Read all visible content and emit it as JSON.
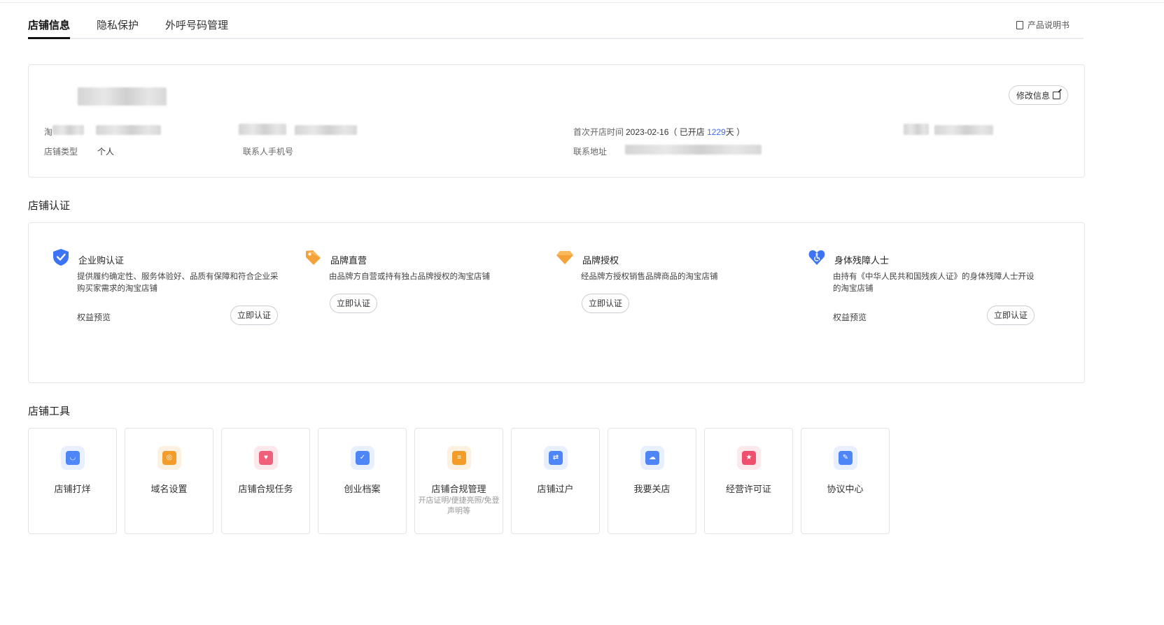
{
  "tabs": [
    {
      "label": "店铺信息"
    },
    {
      "label": "隐私保护"
    },
    {
      "label": "外呼号码管理"
    }
  ],
  "manual_label": "产品说明书",
  "info": {
    "edit_button": "修改信息",
    "shop_label_partial": "淘",
    "first_open_label": "首次开店时间",
    "first_open_date": "2023-02-16",
    "open_prefix": "（ 已开店 ",
    "open_days": "1229",
    "open_suffix": "天 ）",
    "shop_type_label": "店铺类型",
    "shop_type_value": "个人",
    "contact_phone_label": "联系人手机号",
    "address_label": "联系地址"
  },
  "cert_section_title": "店铺认证",
  "certs": [
    {
      "title": "企业购认证",
      "desc": "提供履约确定性、服务体验好、品质有保障和符合企业采购买家需求的淘宝店铺",
      "link": "权益预览",
      "button": "立即认证",
      "icon": "shield-check-icon",
      "color": "#3d73f5"
    },
    {
      "title": "品牌直营",
      "desc": "由品牌方自营或持有独占品牌授权的淘宝店铺",
      "link": "",
      "button": "立即认证",
      "icon": "tag-icon",
      "color": "#f5a23a"
    },
    {
      "title": "品牌授权",
      "desc": "经品牌方授权销售品牌商品的淘宝店铺",
      "link": "",
      "button": "立即认证",
      "icon": "diamond-icon",
      "color": "#f5a23a"
    },
    {
      "title": "身体残障人士",
      "desc": "由持有《中华人民共和国残疾人证》的身体残障人士开设的淘宝店铺",
      "link": "权益预览",
      "button": "立即认证",
      "icon": "heart-accessibility-icon",
      "color": "#3d73f5"
    }
  ],
  "tools_section_title": "店铺工具",
  "tools": [
    {
      "label": "店铺打烊",
      "sub": "",
      "icon": "shop-close-icon",
      "color": "#4f86f7",
      "bg": "#e8f0fe"
    },
    {
      "label": "域名设置",
      "sub": "",
      "icon": "domain-icon",
      "color": "#f39c2a",
      "bg": "#fdf1e1"
    },
    {
      "label": "店铺合规任务",
      "sub": "",
      "icon": "compliance-shield-icon",
      "color": "#f0607a",
      "bg": "#fde8ec"
    },
    {
      "label": "创业档案",
      "sub": "",
      "icon": "archive-icon",
      "color": "#4f86f7",
      "bg": "#e8f0fe"
    },
    {
      "label": "店铺合规管理",
      "sub": "开店证明/便捷亮照/免登声明等",
      "icon": "document-icon",
      "color": "#f39c2a",
      "bg": "#fdf1e1"
    },
    {
      "label": "店铺过户",
      "sub": "",
      "icon": "transfer-icon",
      "color": "#4f86f7",
      "bg": "#e8f0fe"
    },
    {
      "label": "我要关店",
      "sub": "",
      "icon": "close-shop-icon",
      "color": "#4f86f7",
      "bg": "#e8f0fe"
    },
    {
      "label": "经营许可证",
      "sub": "",
      "icon": "license-icon",
      "color": "#ef4f6c",
      "bg": "#fde8ec"
    },
    {
      "label": "协议中心",
      "sub": "",
      "icon": "agreement-icon",
      "color": "#4f86f7",
      "bg": "#e8f0fe"
    }
  ]
}
